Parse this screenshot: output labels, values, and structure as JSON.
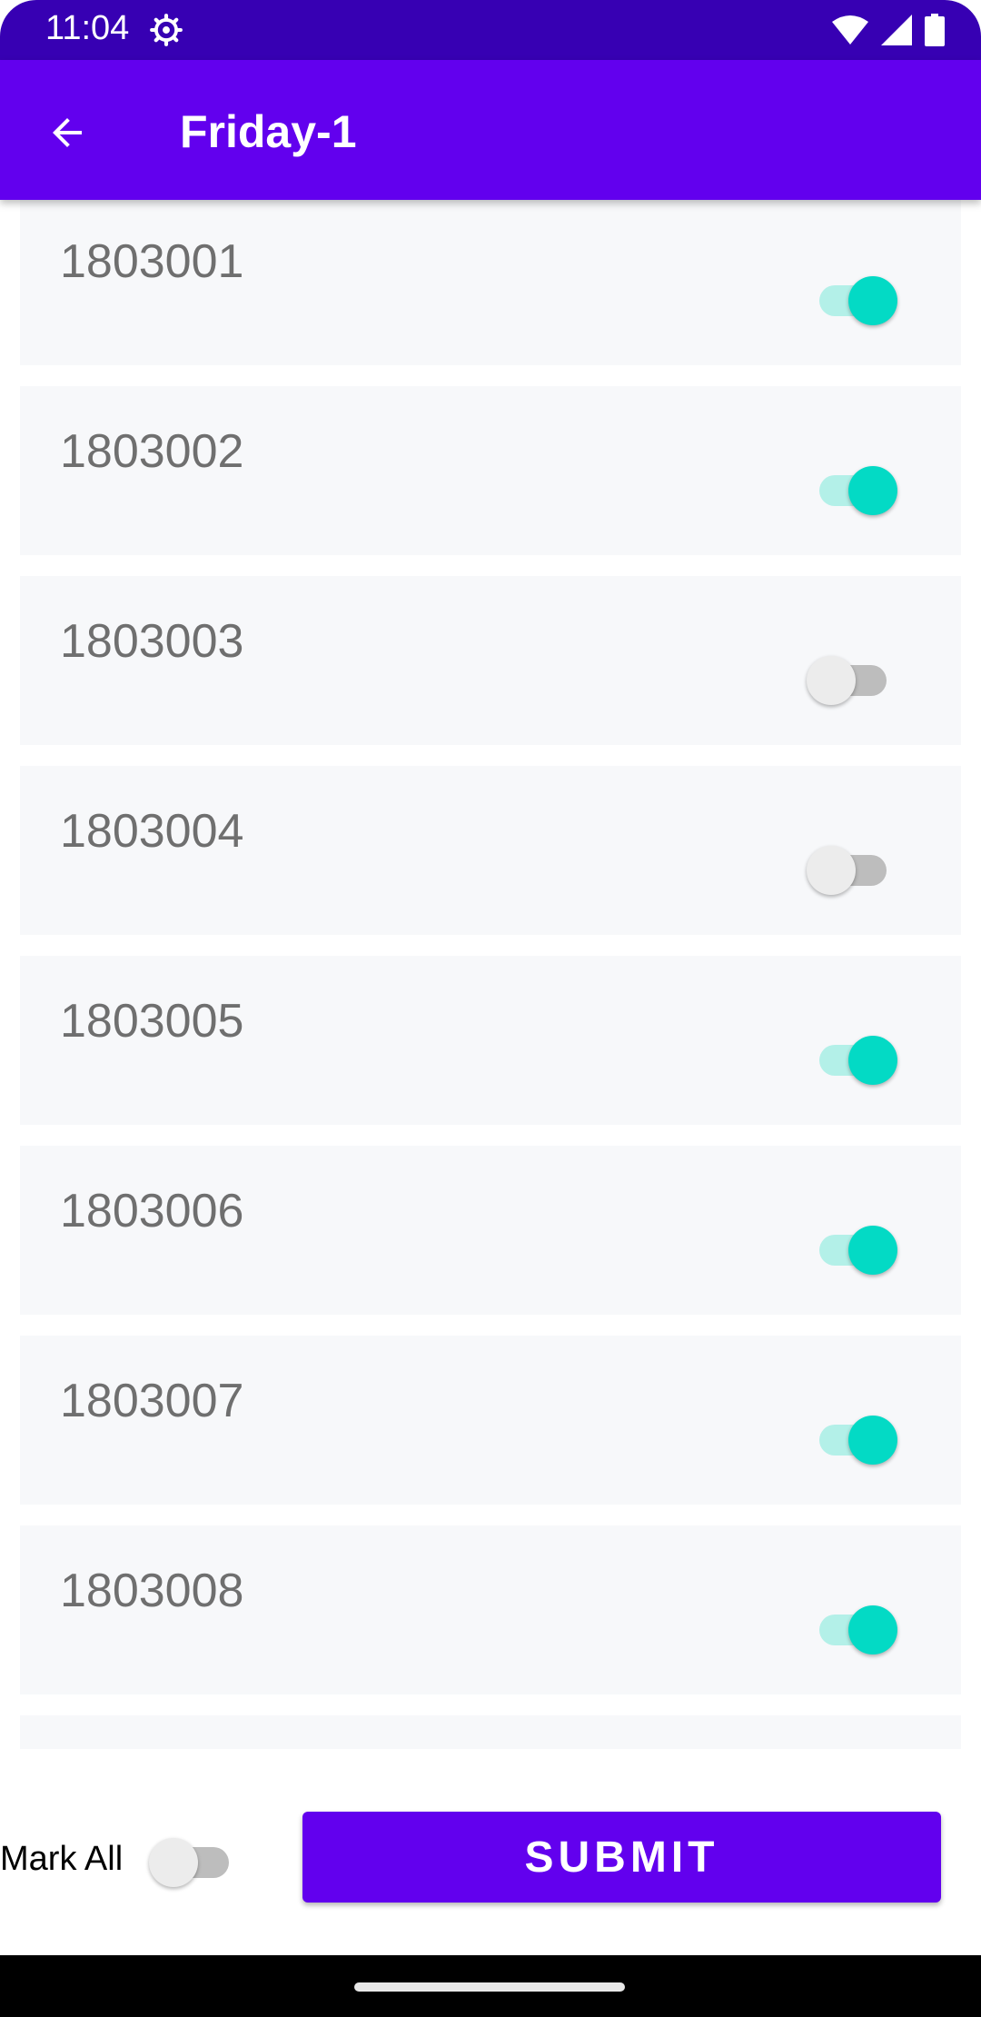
{
  "status_bar": {
    "time": "11:04",
    "icons": [
      "settings-icon",
      "wifi-icon",
      "signal-icon",
      "battery-icon"
    ]
  },
  "app_bar": {
    "title": "Friday-1",
    "back_icon": "arrow-back-icon"
  },
  "students": [
    {
      "id": "1803001",
      "present": true
    },
    {
      "id": "1803002",
      "present": true
    },
    {
      "id": "1803003",
      "present": false
    },
    {
      "id": "1803004",
      "present": false
    },
    {
      "id": "1803005",
      "present": true
    },
    {
      "id": "1803006",
      "present": true
    },
    {
      "id": "1803007",
      "present": true
    },
    {
      "id": "1803008",
      "present": true
    }
  ],
  "footer": {
    "mark_all_label": "Mark All",
    "mark_all_on": false,
    "submit_label": "SUBMIT"
  },
  "colors": {
    "primary": "#6200EE",
    "primary_dark": "#3700B3",
    "accent": "#03DAC5",
    "card_bg": "#F7F8FA"
  }
}
